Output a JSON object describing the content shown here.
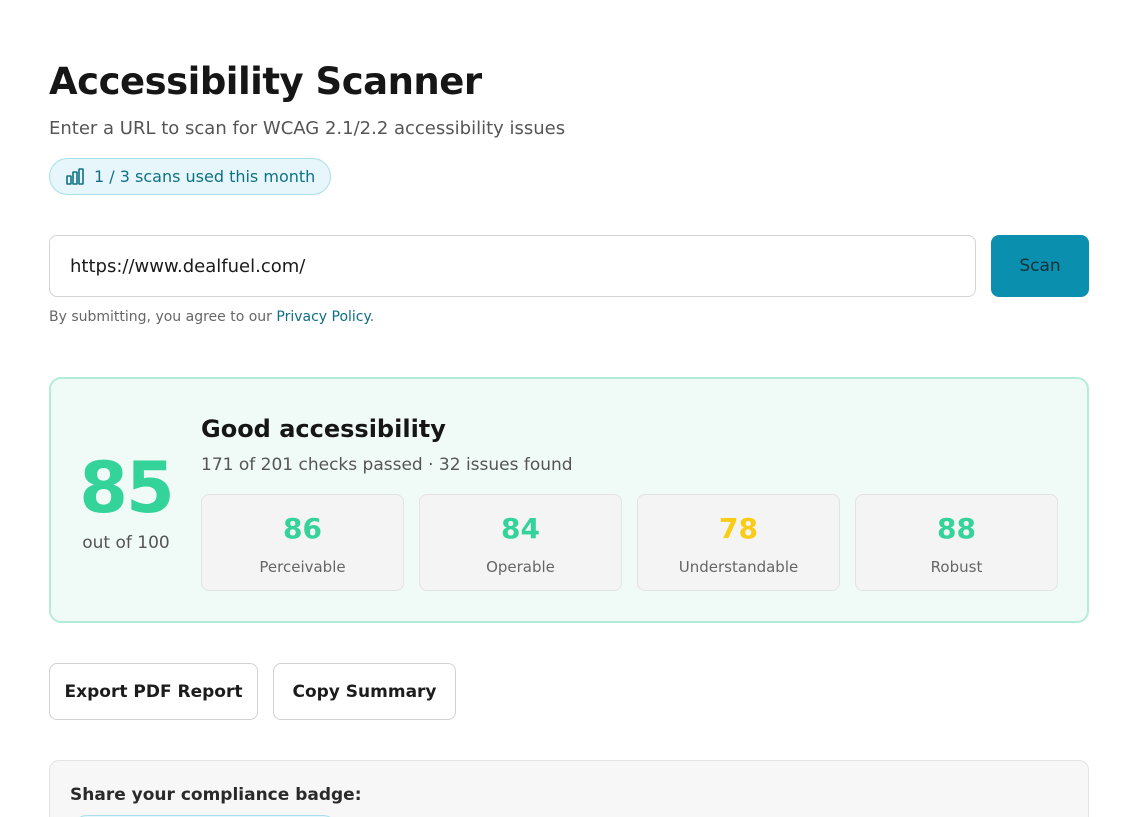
{
  "header": {
    "title": "Accessibility Scanner",
    "subtitle": "Enter a URL to scan for WCAG 2.1/2.2 accessibility issues",
    "usage": {
      "icon": "bar-chart-icon",
      "text": "1 / 3 scans used this month"
    }
  },
  "scan_form": {
    "url_value": "https://www.dealfuel.com/",
    "scan_label": "Scan",
    "consent_prefix": "By submitting, you agree to our ",
    "privacy_link": "Privacy Policy",
    "consent_suffix": "."
  },
  "result": {
    "score": "85",
    "score_sub": "out of 100",
    "rating": "Good accessibility",
    "detail": "171 of 201 checks passed · 32 issues found",
    "metrics": [
      {
        "value": "86",
        "label": "Perceivable",
        "color": "#34d399"
      },
      {
        "value": "84",
        "label": "Operable",
        "color": "#34d399"
      },
      {
        "value": "78",
        "label": "Understandable",
        "color": "#facc15"
      },
      {
        "value": "88",
        "label": "Robust",
        "color": "#34d399"
      }
    ]
  },
  "actions": {
    "export_label": "Export PDF Report",
    "copy_label": "Copy Summary"
  },
  "badge": {
    "label": "Share your compliance badge:"
  },
  "colors": {
    "accent": "#0b8fae",
    "good": "#34d399",
    "warning": "#facc15"
  }
}
